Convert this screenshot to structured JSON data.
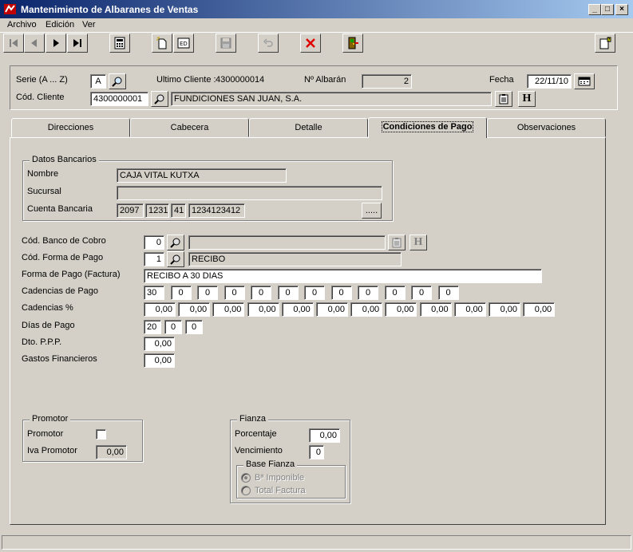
{
  "window": {
    "title": "Mantenimiento de Albaranes de Ventas",
    "minimize": "_",
    "maximize": "□",
    "close": "×"
  },
  "menu": {
    "archivo": "Archivo",
    "edicion": "Edición",
    "ver": "Ver"
  },
  "toolbar": {
    "icons": [
      "first-record-icon",
      "prev-record-icon",
      "next-record-icon",
      "last-record-icon",
      "calculator-icon",
      "new-document-icon",
      "edit-icon",
      "save-icon",
      "undo-icon",
      "delete-icon",
      "exit-icon",
      "help-icon"
    ]
  },
  "header": {
    "serie_label": "Serie (A ... Z)",
    "serie_value": "A",
    "ultimo_cliente_label": "Ultimo Cliente :",
    "ultimo_cliente_value": "4300000014",
    "albaran_label": "Nº Albarán",
    "albaran_value": "2",
    "fecha_label": "Fecha",
    "fecha_value": "22/11/10",
    "cod_cliente_label": "Cód. Cliente",
    "cod_cliente_value": "4300000001",
    "cliente_nombre": "FUNDICIONES SAN JUAN, S.A.",
    "h_button": "H"
  },
  "tabs": [
    {
      "label": "Direcciones"
    },
    {
      "label": "Cabecera"
    },
    {
      "label": "Detalle"
    },
    {
      "label": "Condiciones de Pago"
    },
    {
      "label": "Observaciones"
    }
  ],
  "datos_bancarios": {
    "title": "Datos Bancarios",
    "nombre_label": "Nombre",
    "nombre_value": "CAJA VITAL KUTXA",
    "sucursal_label": "Sucursal",
    "sucursal_value": "",
    "cuenta_label": "Cuenta Bancaria",
    "cuenta_entidad": "2097",
    "cuenta_oficina": "1231",
    "cuenta_dc": "41",
    "cuenta_numero": "1234123412",
    "ellipsis": "....."
  },
  "pago": {
    "banco_cobro_label": "Cód. Banco de Cobro",
    "banco_cobro_value": "0",
    "banco_cobro_desc": "",
    "h_button": "H",
    "forma_pago_label": "Cód. Forma de Pago",
    "forma_pago_value": "1",
    "forma_pago_desc": "RECIBO",
    "forma_pago_factura_label": "Forma de Pago (Factura)",
    "forma_pago_factura_value": "RECIBO A 30 DIAS",
    "cadencias_label": "Cadencias de Pago",
    "cadencias": [
      "30",
      "0",
      "0",
      "0",
      "0",
      "0",
      "0",
      "0",
      "0",
      "0",
      "0",
      "0"
    ],
    "cadencias_pct_label": "Cadencias %",
    "cadencias_pct": [
      "0,00",
      "0,00",
      "0,00",
      "0,00",
      "0,00",
      "0,00",
      "0,00",
      "0,00",
      "0,00",
      "0,00",
      "0,00",
      "0,00"
    ],
    "dias_label": "Días de Pago",
    "dias": [
      "20",
      "0",
      "0"
    ],
    "dto_label": "Dto. P.P.P.",
    "dto_value": "0,00",
    "gastos_label": "Gastos Financieros",
    "gastos_value": "0,00"
  },
  "promotor": {
    "title": "Promotor",
    "promotor_label": "Promotor",
    "iva_label": "Iva Promotor",
    "iva_value": "0,00"
  },
  "fianza": {
    "title": "Fianza",
    "porcentaje_label": "Porcentaje",
    "porcentaje_value": "0,00",
    "vencimiento_label": "Vencimiento",
    "vencimiento_value": "0",
    "base_title": "Base Fianza",
    "base_imponible": "Bª Imponible",
    "total_factura": "Total Factura"
  }
}
